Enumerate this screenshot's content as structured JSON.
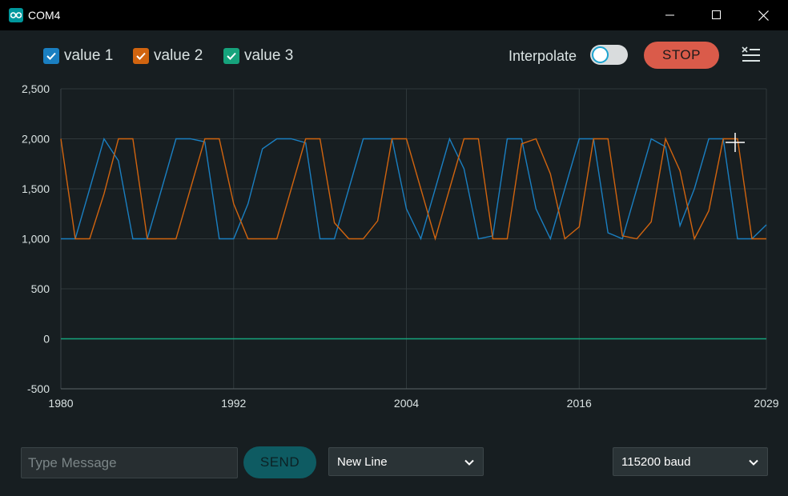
{
  "window": {
    "title": "COM4"
  },
  "legend": [
    {
      "label": "value 1",
      "color": "#1a7fc1",
      "checked": true
    },
    {
      "label": "value 2",
      "color": "#d1640f",
      "checked": true
    },
    {
      "label": "value 3",
      "color": "#16a37c",
      "checked": true
    }
  ],
  "controls": {
    "interpolate_label": "Interpolate",
    "interpolate_on": false,
    "stop_label": "STOP"
  },
  "bottom": {
    "message_placeholder": "Type Message",
    "send_label": "SEND",
    "line_ending": "New Line",
    "baud": "115200 baud"
  },
  "chart_data": {
    "type": "line",
    "ylim": [
      -500,
      2500
    ],
    "yticks": [
      -500,
      0,
      500,
      1000,
      1500,
      2000,
      2500
    ],
    "ytick_labels": [
      "-500",
      "0",
      "500",
      "1,000",
      "1,500",
      "2,000",
      "2,500"
    ],
    "xlim": [
      1980,
      2029
    ],
    "xticks": [
      1980,
      1992,
      2004,
      2016,
      2029
    ],
    "xtick_labels": [
      "1980",
      "1992",
      "2004",
      "2016",
      "2029"
    ],
    "grid": true,
    "series": [
      {
        "name": "value 1",
        "color": "#1a7fc1",
        "x": [
          1980,
          1981,
          1982,
          1983,
          1984,
          1985,
          1986,
          1987,
          1988,
          1989,
          1990,
          1991,
          1992,
          1993,
          1994,
          1995,
          1996,
          1997,
          1998,
          1999,
          2000,
          2001,
          2002,
          2003,
          2004,
          2005,
          2006,
          2007,
          2008,
          2009,
          2010,
          2011,
          2012,
          2013,
          2014,
          2015,
          2016,
          2017,
          2018,
          2019,
          2020,
          2021,
          2022,
          2023,
          2024,
          2025,
          2026,
          2027,
          2028,
          2029
        ],
        "values": [
          1000,
          1000,
          1500,
          2000,
          1780,
          1000,
          1000,
          1500,
          2000,
          2000,
          1970,
          1000,
          1000,
          1350,
          1900,
          2000,
          2000,
          1960,
          1000,
          1000,
          1500,
          2000,
          2000,
          2000,
          1300,
          1000,
          1500,
          2000,
          1700,
          1000,
          1030,
          2000,
          2000,
          1300,
          1000,
          1500,
          2000,
          2000,
          1060,
          1000,
          1500,
          2000,
          1920,
          1130,
          1500,
          2000,
          2000,
          1000,
          1000,
          1140
        ]
      },
      {
        "name": "value 2",
        "color": "#d1640f",
        "x": [
          1980,
          1981,
          1982,
          1983,
          1984,
          1985,
          1986,
          1987,
          1988,
          1989,
          1990,
          1991,
          1992,
          1993,
          1994,
          1995,
          1996,
          1997,
          1998,
          1999,
          2000,
          2001,
          2002,
          2003,
          2004,
          2005,
          2006,
          2007,
          2008,
          2009,
          2010,
          2011,
          2012,
          2013,
          2014,
          2015,
          2016,
          2017,
          2018,
          2019,
          2020,
          2021,
          2022,
          2023,
          2024,
          2025,
          2026,
          2027,
          2028,
          2029
        ],
        "values": [
          2000,
          1000,
          1000,
          1450,
          2000,
          2000,
          1000,
          1000,
          1000,
          1500,
          2000,
          2000,
          1350,
          1000,
          1000,
          1000,
          1500,
          2000,
          2000,
          1160,
          1000,
          1000,
          1180,
          2000,
          2000,
          1500,
          1000,
          1500,
          2000,
          2000,
          1000,
          1000,
          1950,
          2000,
          1650,
          1000,
          1120,
          2000,
          2000,
          1030,
          1000,
          1170,
          2000,
          1680,
          1000,
          1280,
          2000,
          2000,
          1000,
          1000
        ]
      },
      {
        "name": "value 3",
        "color": "#16a37c",
        "x": [
          1980,
          2029
        ],
        "values": [
          0,
          0
        ]
      }
    ]
  }
}
